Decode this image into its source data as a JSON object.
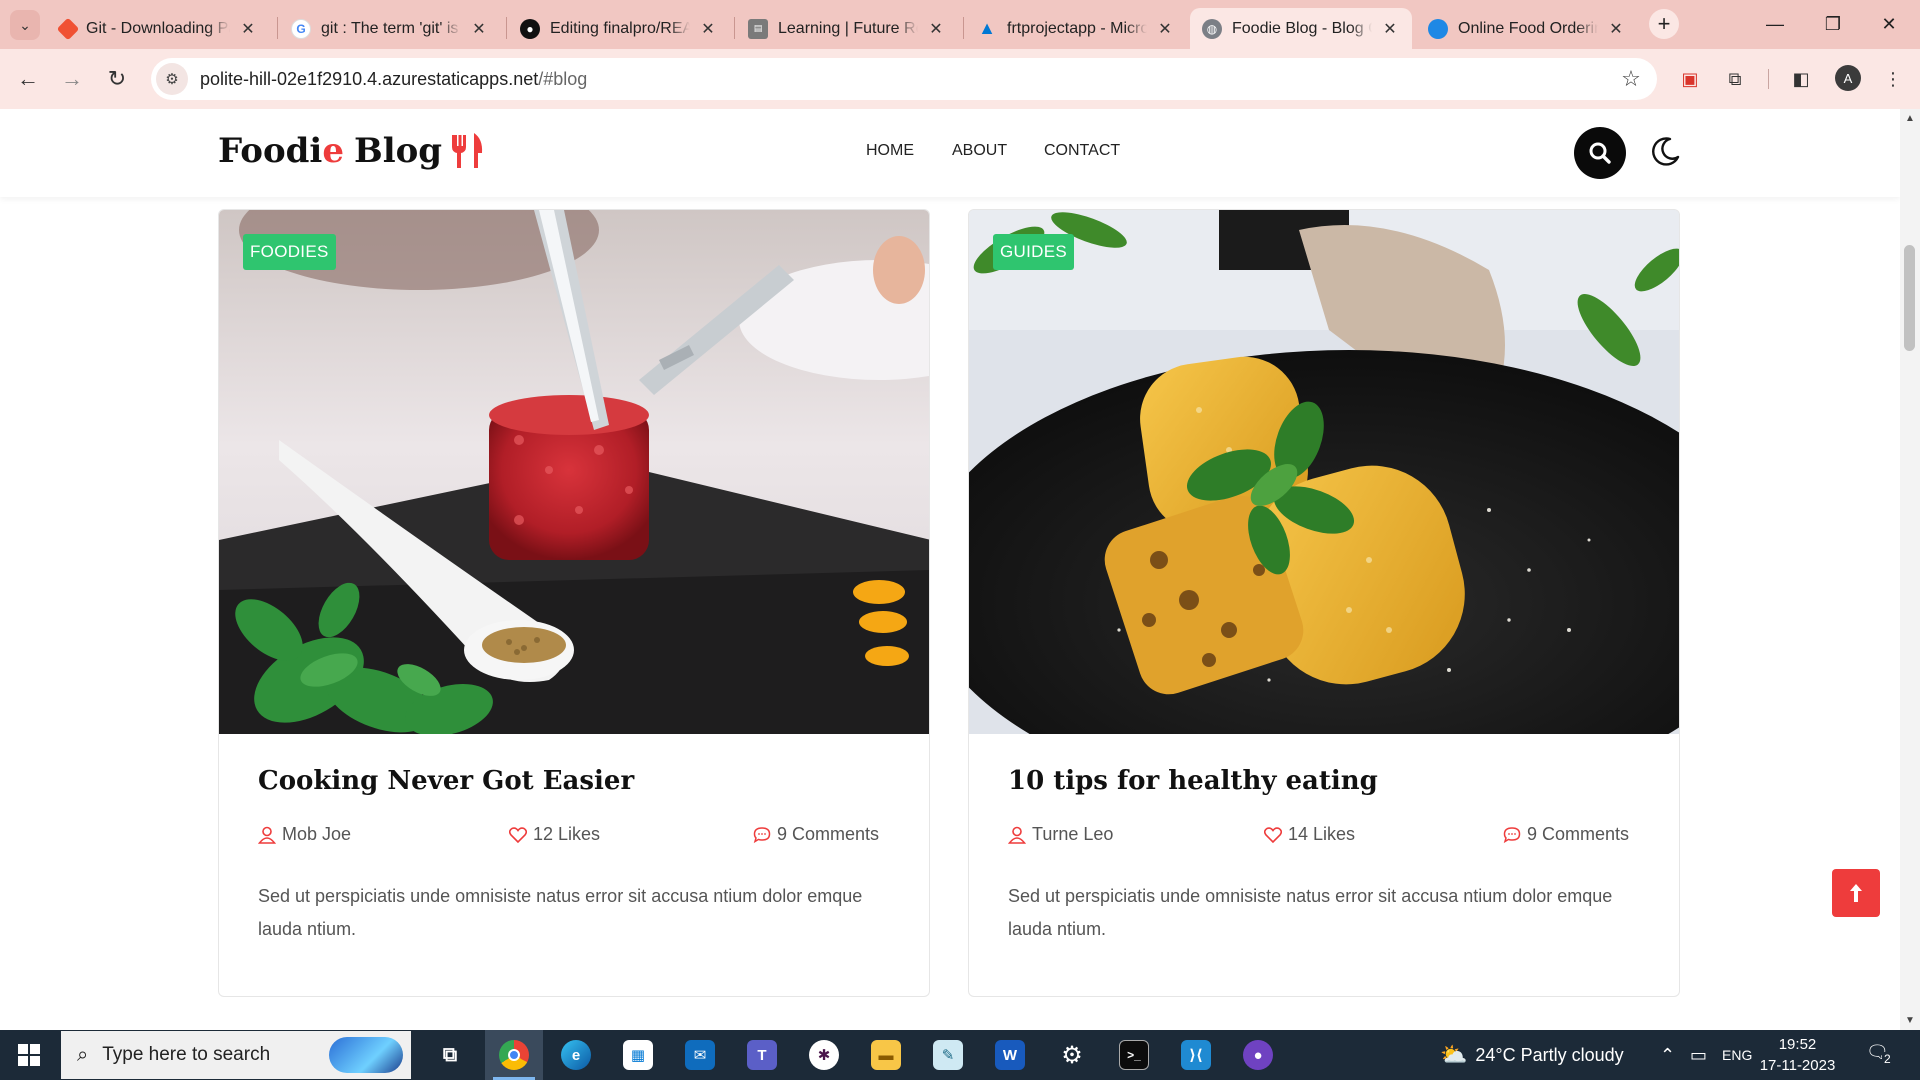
{
  "browser": {
    "tabs": [
      {
        "label": "Git - Downloading Package",
        "favicon": "git-favicon",
        "color": "#f05133"
      },
      {
        "label": "git : The term 'git' is not",
        "favicon": "google-favicon",
        "color": "#4285f4"
      },
      {
        "label": "Editing finalpro/README",
        "favicon": "github-favicon",
        "color": "#111111"
      },
      {
        "label": "Learning | Future Ready",
        "favicon": "learning-favicon",
        "color": "#6b6b6b"
      },
      {
        "label": "frtprojectapp - Microsoft",
        "favicon": "azure-favicon",
        "color": "#0078d4"
      },
      {
        "label": "Foodie Blog - Blog Grid",
        "favicon": "globe-favicon",
        "color": "#5f6368"
      },
      {
        "label": "Online Food Ordering",
        "favicon": "site-favicon",
        "color": "#1e88e5"
      }
    ],
    "active_tab_index": 5,
    "url_host": "polite-hill-02e1f2910.4.azurestaticapps.net",
    "url_path": "/#blog",
    "profile_initial": "A"
  },
  "site": {
    "logo": {
      "part1": "Foodi",
      "part2": "e",
      "part3": "Blog"
    },
    "nav": [
      {
        "label": "HOME",
        "active": true
      },
      {
        "label": "ABOUT",
        "active": false
      },
      {
        "label": "CONTACT",
        "active": false
      }
    ],
    "accent": "#ee3c3c",
    "badge_color": "#2fc56f"
  },
  "posts": [
    {
      "category": "FOODIES",
      "title": "Cooking Never Got Easier",
      "author": "Mob Joe",
      "likes": "12 Likes",
      "comments": "9 Comments",
      "excerpt": "Sed ut perspiciatis unde omnisiste natus error sit accusa ntium dolor emque lauda ntium.",
      "image": "beef-tartare-on-slate"
    },
    {
      "category": "GUIDES",
      "title": "10 tips for healthy eating",
      "author": "Turne Leo",
      "likes": "14 Likes",
      "comments": "9 Comments",
      "excerpt": "Sed ut perspiciatis unde omnisiste natus error sit accusa ntium dolor emque lauda ntium.",
      "image": "grilled-corn-on-black-plate"
    }
  ],
  "taskbar": {
    "search_placeholder": "Type here to search",
    "weather": "24°C  Partly cloudy",
    "language": "ENG",
    "time": "19:52",
    "date": "17-11-2023",
    "notification_count": "2",
    "apps": [
      "task-view",
      "chrome",
      "edge",
      "store",
      "mail",
      "teams",
      "slack",
      "file-explorer",
      "notes",
      "word",
      "settings",
      "terminal",
      "vscode",
      "github-desktop"
    ]
  }
}
